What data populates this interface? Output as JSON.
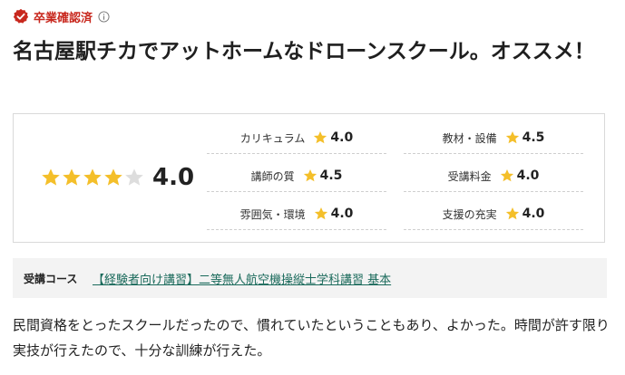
{
  "badge": {
    "label": "卒業確認済",
    "icon": "verified-check-icon",
    "info_icon": "info-icon",
    "color": "#c8281e"
  },
  "title": "名古屋駅チカでアットホームなドローンスクール。オススメ！",
  "rating": {
    "overall_score": "4.0",
    "overall_stars": 4,
    "max_stars": 5,
    "star_color": "#f4bf2a",
    "empty_star_color": "#dddddd",
    "categories": [
      {
        "label": "カリキュラム",
        "score": "4.0"
      },
      {
        "label": "教材・設備",
        "score": "4.5"
      },
      {
        "label": "講師の質",
        "score": "4.5"
      },
      {
        "label": "受講料金",
        "score": "4.0"
      },
      {
        "label": "雰囲気・環境",
        "score": "4.0"
      },
      {
        "label": "支援の充実",
        "score": "4.0"
      }
    ]
  },
  "course": {
    "key": "受講コース",
    "link_text": "【経験者向け講習】二等無人航空機操縦士学科講習 基本",
    "link_color": "#1a6a5b"
  },
  "review": {
    "text": "民間資格をとったスクールだったので、慣れていたということもあり、よかった。時間が許す限り実技が行えたので、十分な訓練が行えた。"
  }
}
